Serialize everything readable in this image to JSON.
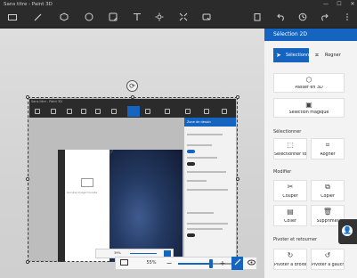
{
  "window": {
    "title": "Sans titre - Paint 3D"
  },
  "window_controls": [
    "—",
    "☐",
    "✕"
  ],
  "toolbar": {
    "left_icons": [
      "folder-icon",
      "brush-icon",
      "3d-shapes-icon",
      "2d-shapes-icon",
      "stickers-icon",
      "text-icon",
      "effects-icon",
      "canvas-icon",
      "mixed-reality-icon"
    ],
    "right_icons": [
      "paste-icon",
      "undo-icon",
      "history-icon",
      "redo-icon",
      "menu-icon"
    ]
  },
  "side_panel": {
    "title": "Sélection 2D",
    "modes": [
      {
        "label": "Sélectionner",
        "active": true
      },
      {
        "label": "Rogner",
        "active": false
      }
    ],
    "actions": [
      {
        "label": "Passer en 3D"
      },
      {
        "label": "Sélection magique"
      }
    ],
    "sections": {
      "select": {
        "title": "Sélectionner",
        "items": [
          {
            "label": "Sélectionner tout"
          },
          {
            "label": "Rogner"
          }
        ]
      },
      "edit": {
        "title": "Modifier",
        "items": [
          {
            "label": "Couper"
          },
          {
            "label": "Copier"
          },
          {
            "label": "Coller"
          },
          {
            "label": "Supprimer"
          }
        ]
      },
      "rotate": {
        "title": "Pivoter et retourner",
        "items": [
          {
            "label": "Pivoter à droite"
          },
          {
            "label": "Pivoter à gauche"
          }
        ]
      }
    }
  },
  "zoom": {
    "value_text": "55%",
    "level_fraction": 0.55
  },
  "inner_screenshot": {
    "title": "Sans titre - Paint 3D",
    "panel_title": "Zone de dessin",
    "zoom_text": "39%",
    "doc_text": "Aucune image trouvée"
  },
  "accent": "#1565c0"
}
